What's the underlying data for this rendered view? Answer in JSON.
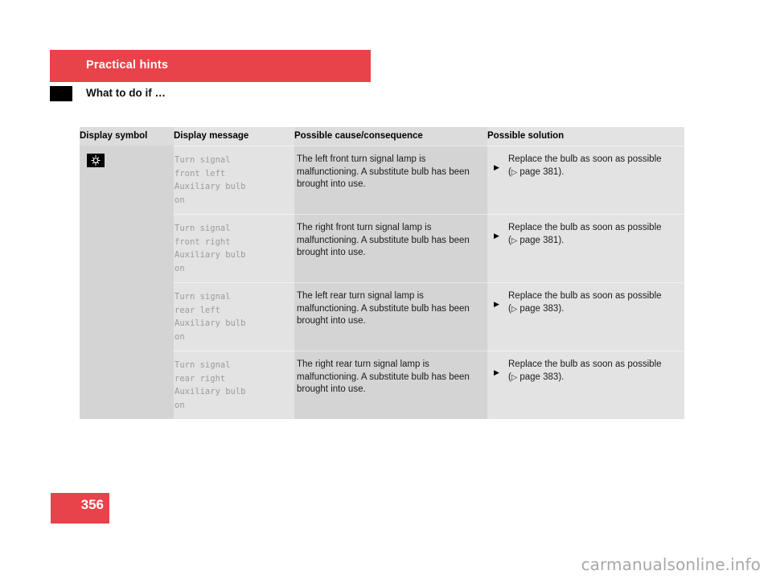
{
  "document": {
    "chapter_title": "Practical hints",
    "section_title": "What to do if …",
    "page_number": "356",
    "watermark": "carmanualsonline.info",
    "accent_color": "#e8434a",
    "marker_color": "#000000"
  },
  "table": {
    "headers": {
      "col1": "Display symbol",
      "col2": "Display message",
      "col3": "Possible cause/consequence",
      "col4": "Possible solution"
    },
    "rows": [
      {
        "symbol_icon": "turn-signal-bulb-icon",
        "has_symbol": true,
        "message": "Turn signal\nfront left\nAuxiliary bulb\non",
        "cause": "The left front turn signal lamp is malfunctioning. A substitute bulb has been brought into use.",
        "solution_bullet": "▶",
        "solution_text": "Replace the bulb as soon as possible",
        "solution_ref_open": "(",
        "solution_ref_tri": "▷",
        "solution_ref_text": " page 381).",
        "page_ref": "381"
      },
      {
        "symbol_icon": "",
        "has_symbol": false,
        "message": "Turn signal\nfront right\nAuxiliary bulb\non",
        "cause": "The right front turn signal lamp is malfunctioning. A substitute bulb has been brought into use.",
        "solution_bullet": "▶",
        "solution_text": "Replace the bulb as soon as possible",
        "solution_ref_open": "(",
        "solution_ref_tri": "▷",
        "solution_ref_text": " page 381).",
        "page_ref": "381"
      },
      {
        "symbol_icon": "",
        "has_symbol": false,
        "message": "Turn signal\nrear left\nAuxiliary bulb\non",
        "cause": "The left rear turn signal lamp is malfunctioning. A substitute bulb has been brought into use.",
        "solution_bullet": "▶",
        "solution_text": "Replace the bulb as soon as possible",
        "solution_ref_open": "(",
        "solution_ref_tri": "▷",
        "solution_ref_text": " page 383).",
        "page_ref": "383"
      },
      {
        "symbol_icon": "",
        "has_symbol": false,
        "message": "Turn signal\nrear right\nAuxiliary bulb\non",
        "cause": "The right rear turn signal lamp is malfunctioning. A substitute bulb has been brought into use.",
        "solution_bullet": "▶",
        "solution_text": "Replace the bulb as soon as possible",
        "solution_ref_open": "(",
        "solution_ref_tri": "▷",
        "solution_ref_text": " page 383).",
        "page_ref": "383"
      }
    ]
  }
}
